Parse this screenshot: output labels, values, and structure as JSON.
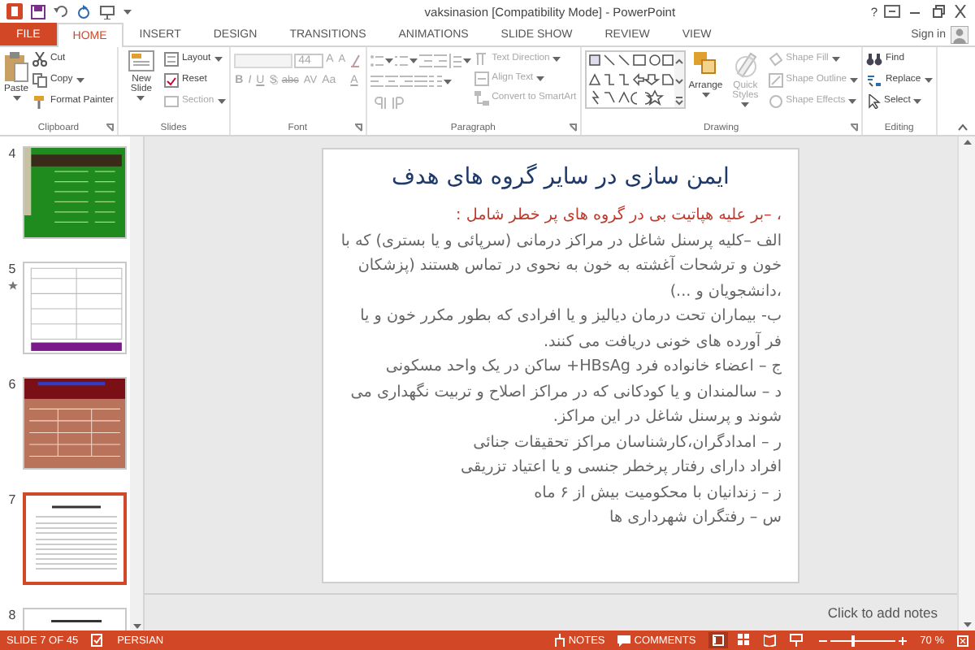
{
  "window": {
    "title": "vaksinasion [Compatibility Mode] - PowerPoint",
    "help": "?",
    "sign_in": "Sign in"
  },
  "tabs": [
    {
      "label": "FILE",
      "kind": "file",
      "selected": false
    },
    {
      "label": "HOME",
      "kind": "tab",
      "selected": true
    },
    {
      "label": "INSERT",
      "kind": "tab",
      "selected": false
    },
    {
      "label": "DESIGN",
      "kind": "tab",
      "selected": false
    },
    {
      "label": "TRANSITIONS",
      "kind": "tab",
      "selected": false
    },
    {
      "label": "ANIMATIONS",
      "kind": "tab",
      "selected": false
    },
    {
      "label": "SLIDE SHOW",
      "kind": "tab",
      "selected": false
    },
    {
      "label": "REVIEW",
      "kind": "tab",
      "selected": false
    },
    {
      "label": "VIEW",
      "kind": "tab",
      "selected": false
    }
  ],
  "clipboard": {
    "label": "Clipboard",
    "paste": "Paste",
    "cut": "Cut",
    "copy": "Copy",
    "format_painter": "Format Painter"
  },
  "slides_group": {
    "label": "Slides",
    "new_slide": "New Slide",
    "layout": "Layout",
    "reset": "Reset",
    "section": {
      "label": "Section",
      "disabled": true
    }
  },
  "font": {
    "label": "Font",
    "disabled": true,
    "size": "44",
    "grow": "A",
    "shrink": "A",
    "format_buttons": [
      "B",
      "I",
      "U",
      "S",
      "abc",
      "AV",
      "Aa",
      "A"
    ]
  },
  "paragraph": {
    "label": "Paragraph",
    "disabled": true,
    "commands": [
      "Text Direction",
      "Align Text",
      "Convert to SmartArt"
    ]
  },
  "drawing": {
    "label": "Drawing",
    "arrange": "Arrange",
    "quick_styles": {
      "label": "Quick Styles",
      "disabled": true
    },
    "shape_commands": [
      {
        "label": "Shape Fill",
        "disabled": true
      },
      {
        "label": "Shape Outline",
        "disabled": true
      },
      {
        "label": "Shape Effects",
        "disabled": true
      }
    ]
  },
  "editing": {
    "label": "Editing",
    "find": "Find",
    "replace": "Replace",
    "select": "Select"
  },
  "thumbnails": [
    {
      "number": "4",
      "kind": "table",
      "color": "#1f8b1f",
      "selected": false,
      "animated": false
    },
    {
      "number": "5",
      "kind": "form",
      "color": "#ffffff",
      "selected": false,
      "animated": true
    },
    {
      "number": "6",
      "kind": "banner",
      "color": "#b9735a",
      "selected": false,
      "animated": false
    },
    {
      "number": "7",
      "kind": "text",
      "color": "#ffffff",
      "selected": true,
      "animated": false
    },
    {
      "number": "8",
      "kind": "text",
      "color": "#ffffff",
      "selected": false,
      "animated": false
    }
  ],
  "slide": {
    "title": "ایمن سازی در سایر گروه های هدف",
    "lead": "، –بر علیه هپاتیت بی در گروه های پر خطر شامل :",
    "items": [
      "الف –کلیه پرسنل شاغل در مراکز درمانی (سرپائی و یا بستری) که با خون و ترشحات آغشته به خون به نحوی در تماس هستند (پزشکان ،دانشجویان و ...)",
      "ب- بیماران تحت درمان دیالیز و یا افرادی که بطور مکرر خون و یا فر آورده های خونی دریافت می کنند.",
      "ج – اعضاء خانواده فرد HBsAg+ ساکن در یک واحد مسکونی",
      "د – سالمندان و یا کودکانی که در مراکز اصلاح و تربیت نگهداری می شوند و پرسنل شاغل در این مراکز.",
      "ر – امدادگران،کارشناسان مراکز تحقیقات جنائی",
      "افراد دارای رفتار پرخطر جنسی و یا اعتیاد تزریقی",
      "ز – زندانیان با محکومیت بیش از ۶ ماه",
      "س – رفتگران شهرداری ها"
    ]
  },
  "notes": {
    "placeholder": "Click to add notes"
  },
  "status_bar": {
    "slide_info": "SLIDE 7 OF 45",
    "language": "PERSIAN",
    "notes": "NOTES",
    "comments": "COMMENTS",
    "views": [
      {
        "selected": true
      },
      {
        "selected": false
      },
      {
        "selected": false
      },
      {
        "selected": false
      }
    ],
    "zoom": {
      "level": 0.35,
      "reading": "70 %"
    }
  }
}
